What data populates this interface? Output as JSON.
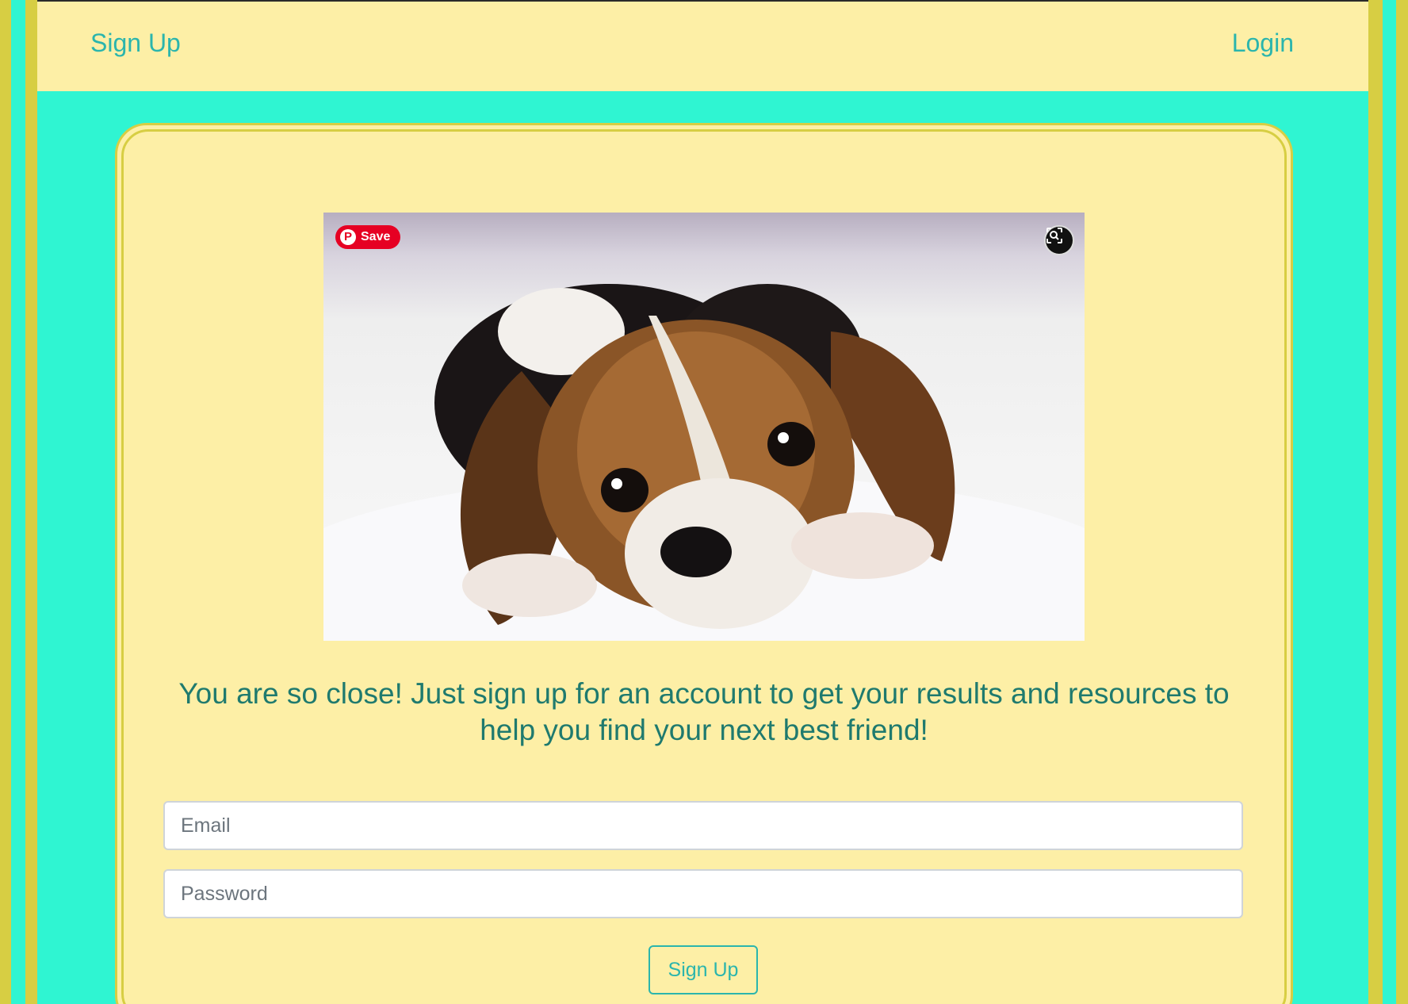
{
  "navbar": {
    "signup_label": "Sign Up",
    "login_label": "Login"
  },
  "hero_image": {
    "subject": "beagle puppy lying on white fluffy blanket",
    "pinterest_save_label": "Save",
    "pinterest_icon": "pinterest-icon",
    "lens_icon": "visual-search-icon"
  },
  "signup": {
    "headline": "You are so close! Just sign up for an account to get your results and resources to help you find your next best friend!",
    "email_placeholder": "Email",
    "password_placeholder": "Password",
    "submit_label": "Sign Up"
  },
  "colors": {
    "background": "#2ff5d2",
    "panel": "#fdefa6",
    "border": "#d7ce43",
    "link": "#2bb5ad",
    "headline": "#1f7a6e",
    "pinterest": "#e60023"
  }
}
